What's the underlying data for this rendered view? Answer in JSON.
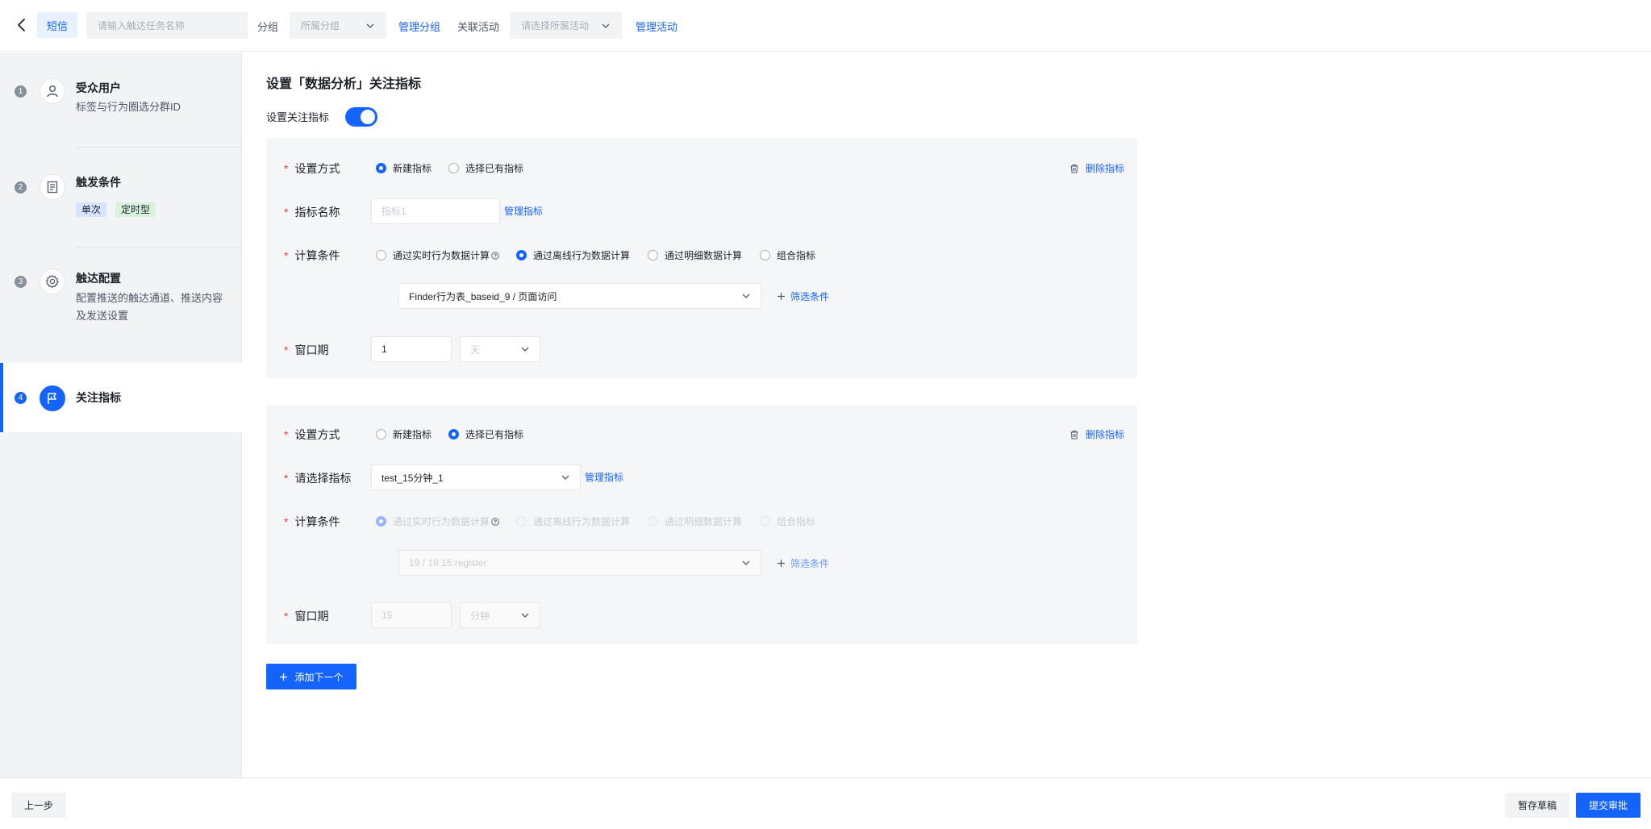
{
  "header": {
    "channel": "短信",
    "task_name_placeholder": "请输入触达任务名称",
    "group_label": "分组",
    "group_placeholder": "所属分组",
    "manage_group": "管理分组",
    "activity_label": "关联活动",
    "activity_placeholder": "请选择所属活动",
    "manage_activity": "管理活动"
  },
  "sidebar": {
    "steps": [
      {
        "num": "1",
        "title": "受众用户",
        "desc": "标签与行为圈选分群ID",
        "icon": "user-icon"
      },
      {
        "num": "2",
        "title": "触发条件",
        "badges": [
          "单次",
          "定时型"
        ],
        "icon": "document-icon"
      },
      {
        "num": "3",
        "title": "触达配置",
        "desc": "配置推送的触达通道、推送内容及发送设置",
        "icon": "gear-icon"
      },
      {
        "num": "4",
        "title": "关注指标",
        "icon": "flag-icon",
        "active": true
      }
    ]
  },
  "main": {
    "title": "设置「数据分析」关注指标",
    "toggle_label": "设置关注指标",
    "toggle_on": true,
    "labels": {
      "method": "设置方式",
      "metric_name": "指标名称",
      "select_metric": "请选择指标",
      "calc": "计算条件",
      "window": "窗口期"
    },
    "method_options": [
      "新建指标",
      "选择已有指标"
    ],
    "calc_options": [
      "通过实时行为数据计算",
      "通过离线行为数据计算",
      "通过明细数据计算",
      "组合指标"
    ],
    "delete_label": "删除指标",
    "manage_metric": "管理指标",
    "filter_label": "筛选条件",
    "cards": [
      {
        "method_selected": 0,
        "metric_name_placeholder": "指标1",
        "calc_selected": 1,
        "source": "Finder行为表_baseid_9 / 页面访问",
        "window_value": "1",
        "window_unit": "天"
      },
      {
        "method_selected": 1,
        "metric_value": "test_15分钟_1",
        "calc_selected": 0,
        "source": "19 / 19:15:register",
        "window_value": "15",
        "window_unit": "分钟"
      }
    ],
    "add_button": "添加下一个"
  },
  "footer": {
    "prev": "上一步",
    "draft": "暂存草稿",
    "submit": "提交审批"
  },
  "colors": {
    "primary": "#1664ff",
    "required": "#f53f3f",
    "sidebar_bg": "#f2f3f5",
    "card_bg": "#f5f6f8"
  }
}
